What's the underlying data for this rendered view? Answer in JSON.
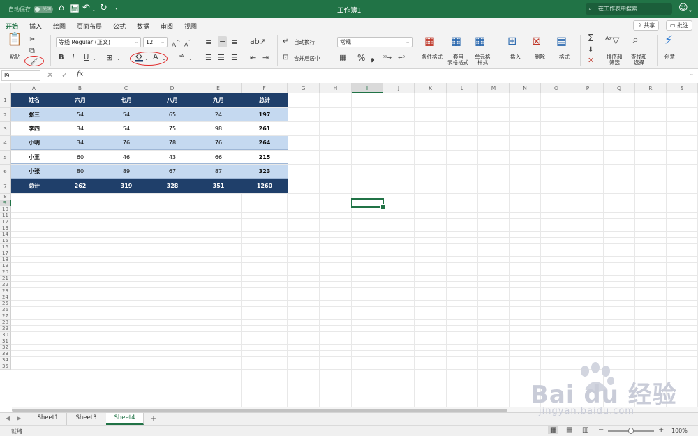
{
  "titlebar": {
    "autosave_label": "自动保存",
    "autosave_state": "关闭",
    "title": "工作簿1",
    "search_placeholder": "在工作表中搜索"
  },
  "ribbon_tabs": [
    {
      "label": "开始",
      "active": true
    },
    {
      "label": "插入"
    },
    {
      "label": "绘图"
    },
    {
      "label": "页面布局"
    },
    {
      "label": "公式"
    },
    {
      "label": "数据"
    },
    {
      "label": "审阅"
    },
    {
      "label": "视图"
    }
  ],
  "share_label": "共享",
  "comment_label": "批注",
  "ribbon": {
    "paste": "粘贴",
    "font_name": "等线 Regular (正文)",
    "font_size": "12",
    "bold": "B",
    "italic": "I",
    "underline": "U",
    "font_color": "A",
    "wrap_text": "自动换行",
    "merge_center": "合并后居中",
    "number_format": "常规",
    "percent": "%",
    "comma": "❟",
    "cond_format": "条件格式",
    "table_format_1": "套用",
    "table_format_2": "表格格式",
    "cell_style_1": "单元格",
    "cell_style_2": "样式",
    "insert": "插入",
    "delete": "删除",
    "format": "格式",
    "sort_filter_1": "排序和",
    "sort_filter_2": "筛选",
    "find_select_1": "查找和",
    "find_select_2": "选择",
    "ideas": "创意"
  },
  "formula_bar": {
    "name_box": "I9",
    "fx": "fx",
    "formula": ""
  },
  "columns": [
    "A",
    "B",
    "C",
    "D",
    "E",
    "F",
    "G",
    "H",
    "I",
    "J",
    "K",
    "L",
    "M",
    "N",
    "O",
    "P",
    "Q",
    "R",
    "S"
  ],
  "row_count": 35,
  "table": {
    "header": [
      "姓名",
      "六月",
      "七月",
      "八月",
      "九月",
      "总计"
    ],
    "rows": [
      [
        "张三",
        "54",
        "54",
        "65",
        "24",
        "197"
      ],
      [
        "李四",
        "34",
        "54",
        "75",
        "98",
        "261"
      ],
      [
        "小明",
        "34",
        "76",
        "78",
        "76",
        "264"
      ],
      [
        "小王",
        "60",
        "46",
        "43",
        "66",
        "215"
      ],
      [
        "小张",
        "80",
        "89",
        "67",
        "87",
        "323"
      ]
    ],
    "total": [
      "总计",
      "262",
      "319",
      "328",
      "351",
      "1260"
    ],
    "colors": {
      "header": "#1f3f6a",
      "band": "#c5d9f0",
      "plain": "#ffffff"
    }
  },
  "sheets": [
    {
      "label": "Sheet1"
    },
    {
      "label": "Sheet3"
    },
    {
      "label": "Sheet4",
      "active": true
    }
  ],
  "add_sheet": "+",
  "status": {
    "ready": "就绪",
    "zoom": "100%",
    "zoom_level": 1.0
  },
  "watermark": {
    "brand": "Bai du 经验",
    "url": "jingyan.baidu.com"
  },
  "accent": "#217346"
}
